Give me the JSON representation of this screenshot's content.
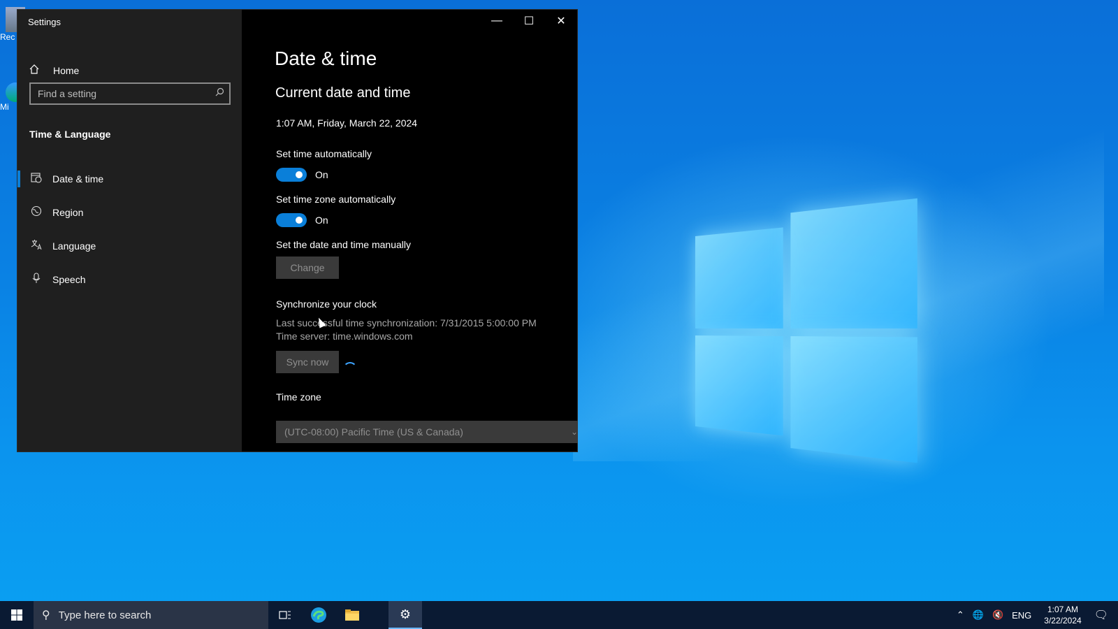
{
  "desktop": {
    "icons": [
      {
        "label": "Rec"
      },
      {
        "label": "Mi"
      }
    ]
  },
  "window": {
    "title": "Settings",
    "controls": [
      "minimize",
      "maximize",
      "close"
    ]
  },
  "sidebar": {
    "home_label": "Home",
    "search_placeholder": "Find a setting",
    "section_title": "Time & Language",
    "items": [
      {
        "label": "Date & time",
        "icon": "calendar-clock-icon",
        "active": true
      },
      {
        "label": "Region",
        "icon": "globe-region-icon",
        "active": false
      },
      {
        "label": "Language",
        "icon": "language-icon",
        "active": false
      },
      {
        "label": "Speech",
        "icon": "microphone-icon",
        "active": false
      }
    ]
  },
  "main": {
    "page_title": "Date & time",
    "section_heading": "Current date and time",
    "current_datetime": "1:07 AM, Friday, March 22, 2024",
    "set_time_auto_label": "Set time automatically",
    "set_time_auto_state": "On",
    "set_tz_auto_label": "Set time zone automatically",
    "set_tz_auto_state": "On",
    "manual_label": "Set the date and time manually",
    "change_button": "Change",
    "sync_heading": "Synchronize your clock",
    "last_sync": "Last successful time synchronization: 7/31/2015 5:00:00 PM",
    "time_server": "Time server: time.windows.com",
    "sync_button": "Sync now",
    "timezone_label": "Time zone",
    "timezone_value": "(UTC-08:00) Pacific Time (US & Canada)"
  },
  "taskbar": {
    "search_placeholder": "Type here to search",
    "language": "ENG",
    "time": "1:07 AM",
    "date": "3/22/2024"
  },
  "colors": {
    "accent": "#0a7fd9",
    "sidebar_bg": "#1f1f1f",
    "content_bg": "#000000",
    "taskbar_bg": "#0a1a33"
  }
}
